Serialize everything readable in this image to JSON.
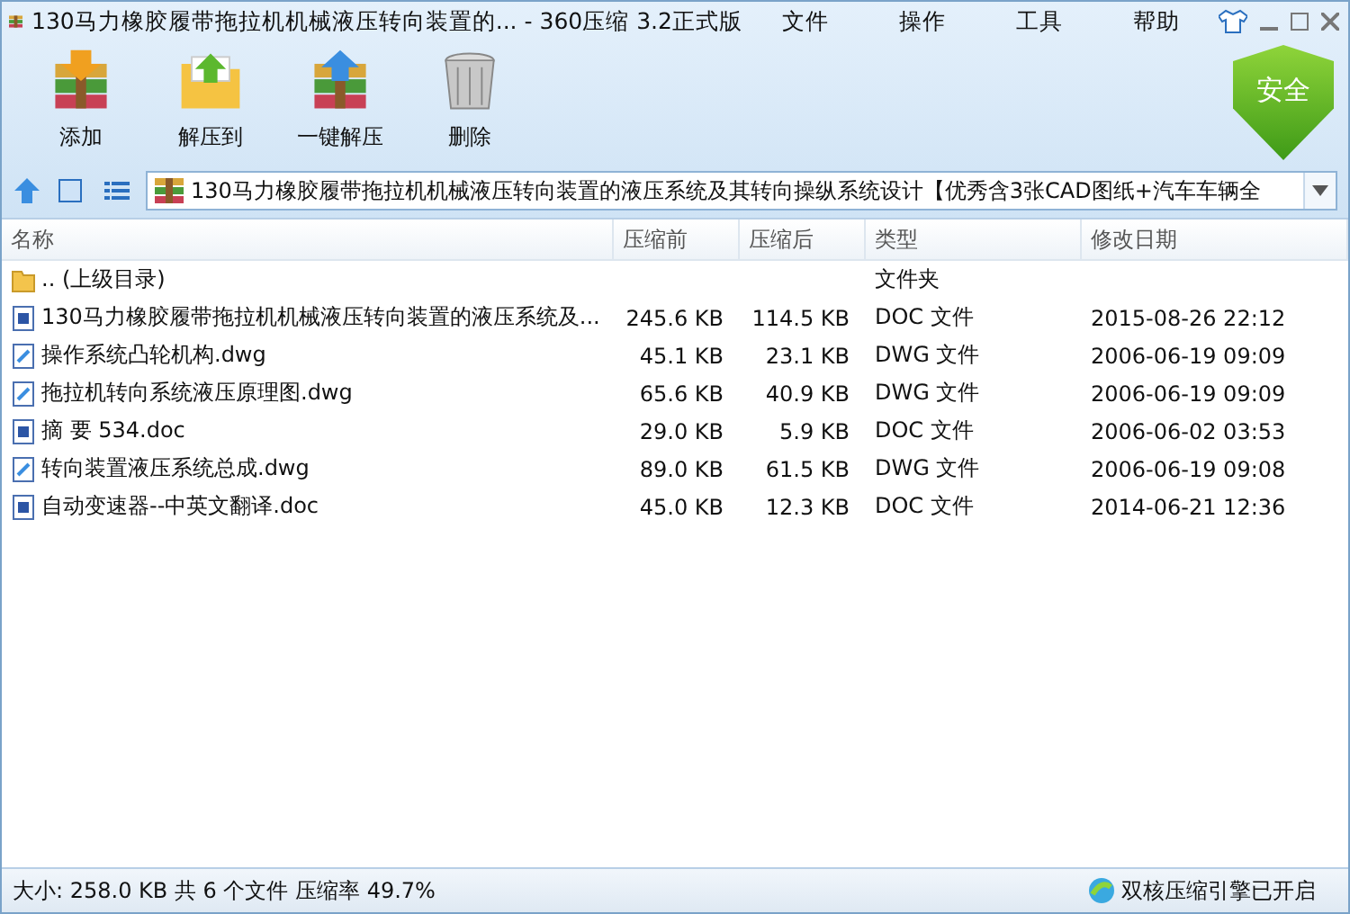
{
  "window": {
    "title": "130马力橡胶履带拖拉机机械液压转向装置的... - 360压缩 3.2正式版"
  },
  "menu": [
    "文件",
    "操作",
    "工具",
    "帮助"
  ],
  "toolbar": [
    {
      "kind": "add",
      "label": "添加"
    },
    {
      "kind": "extract",
      "label": "解压到"
    },
    {
      "kind": "oneclick",
      "label": "一键解压"
    },
    {
      "kind": "delete",
      "label": "删除"
    }
  ],
  "security_badge": "安全",
  "views": [
    {
      "kind": "thumbs"
    },
    {
      "kind": "list"
    }
  ],
  "address": "130马力橡胶履带拖拉机机械液压转向装置的液压系统及其转向操纵系统设计【优秀含3张CAD图纸+汽车车辆全",
  "table": {
    "columns": [
      "名称",
      "压缩前",
      "压缩后",
      "类型",
      "修改日期"
    ],
    "rows": [
      {
        "kind": "folder",
        "name": ".. (上级目录)",
        "size": "",
        "packed": "",
        "type": "文件夹",
        "date": ""
      },
      {
        "kind": "doc",
        "name": "130马力橡胶履带拖拉机机械液压转向装置的液压系统及...",
        "size": "245.6 KB",
        "packed": "114.5 KB",
        "type": "DOC 文件",
        "date": "2015-08-26 22:12"
      },
      {
        "kind": "dwg",
        "name": "操作系统凸轮机构.dwg",
        "size": "45.1 KB",
        "packed": "23.1 KB",
        "type": "DWG 文件",
        "date": "2006-06-19 09:09"
      },
      {
        "kind": "dwg",
        "name": "拖拉机转向系统液压原理图.dwg",
        "size": "65.6 KB",
        "packed": "40.9 KB",
        "type": "DWG 文件",
        "date": "2006-06-19 09:09"
      },
      {
        "kind": "doc",
        "name": "摘 要  534.doc",
        "size": "29.0 KB",
        "packed": "5.9 KB",
        "type": "DOC 文件",
        "date": "2006-06-02 03:53"
      },
      {
        "kind": "dwg",
        "name": "转向装置液压系统总成.dwg",
        "size": "89.0 KB",
        "packed": "61.5 KB",
        "type": "DWG 文件",
        "date": "2006-06-19 09:08"
      },
      {
        "kind": "doc",
        "name": "自动变速器--中英文翻译.doc",
        "size": "45.0 KB",
        "packed": "12.3 KB",
        "type": "DOC 文件",
        "date": "2014-06-21 12:36"
      }
    ]
  },
  "status_bar": {
    "summary": "大小: 258.0 KB 共 6 个文件 压缩率 49.7%",
    "engine": "双核压缩引擎已开启"
  }
}
